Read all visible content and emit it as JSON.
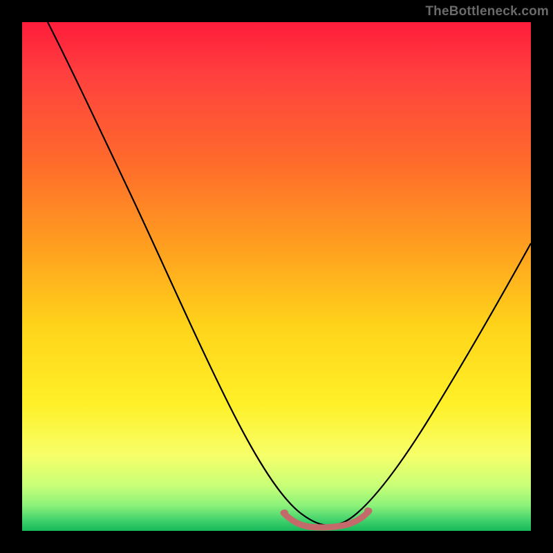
{
  "watermark": "TheBottleneck.com",
  "chart_data": {
    "type": "line",
    "title": "",
    "xlabel": "",
    "ylabel": "",
    "x_range": [
      0,
      100
    ],
    "y_range": [
      0,
      100
    ],
    "series": [
      {
        "name": "bottleneck-curve",
        "description": "V-shaped curve descending from upper-left, touching the bottom around x≈55–60%, then rising to upper-right",
        "x": [
          5,
          10,
          15,
          20,
          25,
          30,
          35,
          40,
          45,
          50,
          55,
          58,
          62,
          65,
          70,
          75,
          80,
          85,
          90,
          95,
          100
        ],
        "y": [
          100,
          89,
          78,
          67,
          56,
          45,
          34,
          24,
          14,
          6,
          1,
          0,
          0,
          2,
          8,
          16,
          25,
          34,
          44,
          53,
          62
        ]
      },
      {
        "name": "optimal-highlight",
        "description": "small highlighted region at the valley floor",
        "x": [
          51,
          53,
          55,
          57,
          59,
          61,
          63
        ],
        "y": [
          3.5,
          2,
          1,
          0.6,
          0.6,
          1,
          2.5
        ]
      }
    ],
    "colors": {
      "curve": "#000000",
      "highlight": "#c86666",
      "gradient_top": "#ff1c3b",
      "gradient_mid": "#ffd41a",
      "gradient_bottom": "#17b85a"
    },
    "grid": false,
    "legend": false
  }
}
